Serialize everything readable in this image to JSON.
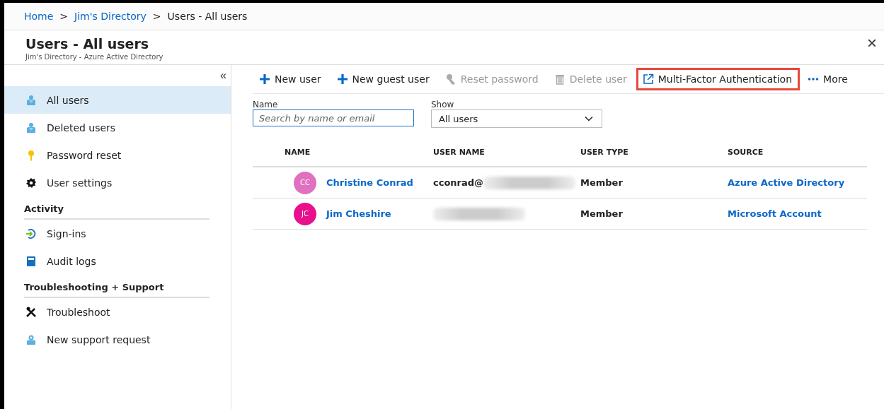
{
  "breadcrumb": [
    {
      "label": "Home",
      "link": true
    },
    {
      "label": ">",
      "link": false
    },
    {
      "label": "Jim's Directory",
      "link": true
    },
    {
      "label": ">",
      "link": false
    },
    {
      "label": "Users - All users",
      "link": false
    }
  ],
  "blade": {
    "title": "Users - All users",
    "subtitle": "Jim's Directory - Azure Active Directory",
    "close": "×"
  },
  "sidebar": {
    "collapse": "«",
    "sections": [
      {
        "items": [
          {
            "label": "All users",
            "kind": "user",
            "selected": true
          },
          {
            "label": "Deleted users",
            "kind": "user",
            "selected": false
          },
          {
            "label": "Password reset",
            "kind": "key",
            "selected": false
          },
          {
            "label": "User settings",
            "kind": "gear",
            "selected": false
          }
        ]
      },
      {
        "heading": "Activity",
        "items": [
          {
            "label": "Sign-ins",
            "kind": "signin",
            "selected": false
          },
          {
            "label": "Audit logs",
            "kind": "book",
            "selected": false
          }
        ]
      },
      {
        "heading": "Troubleshooting + Support",
        "items": [
          {
            "label": "Troubleshoot",
            "kind": "tools",
            "selected": false
          },
          {
            "label": "New support request",
            "kind": "support",
            "selected": false
          }
        ]
      }
    ]
  },
  "toolbar": [
    {
      "label": "New user",
      "kind": "plus",
      "disabled": false,
      "highlighted": false
    },
    {
      "label": "New guest user",
      "kind": "plus",
      "disabled": false,
      "highlighted": false
    },
    {
      "label": "Reset password",
      "kind": "key",
      "disabled": true,
      "highlighted": false
    },
    {
      "label": "Delete user",
      "kind": "trash",
      "disabled": true,
      "highlighted": false
    },
    {
      "label": "Multi-Factor Authentication",
      "kind": "external",
      "disabled": false,
      "highlighted": true
    },
    {
      "label": "More",
      "kind": "dots",
      "disabled": false,
      "highlighted": false
    }
  ],
  "filters": {
    "name": {
      "label": "Name",
      "placeholder": "Search by name or email"
    },
    "show": {
      "label": "Show",
      "value": "All users"
    }
  },
  "table": {
    "columns": [
      "NAME",
      "USER NAME",
      "USER TYPE",
      "SOURCE"
    ],
    "rows": [
      {
        "initials": "CC",
        "color": "#e070c0",
        "name": "Christine Conrad",
        "user_name": "cconrad@",
        "redacted": true,
        "user_type": "Member",
        "source": "Azure Active Directory"
      },
      {
        "initials": "JC",
        "color": "#e8108c",
        "name": "Jim Cheshire",
        "redacted": true,
        "user_type": "Member",
        "source": "Microsoft Account"
      }
    ]
  }
}
